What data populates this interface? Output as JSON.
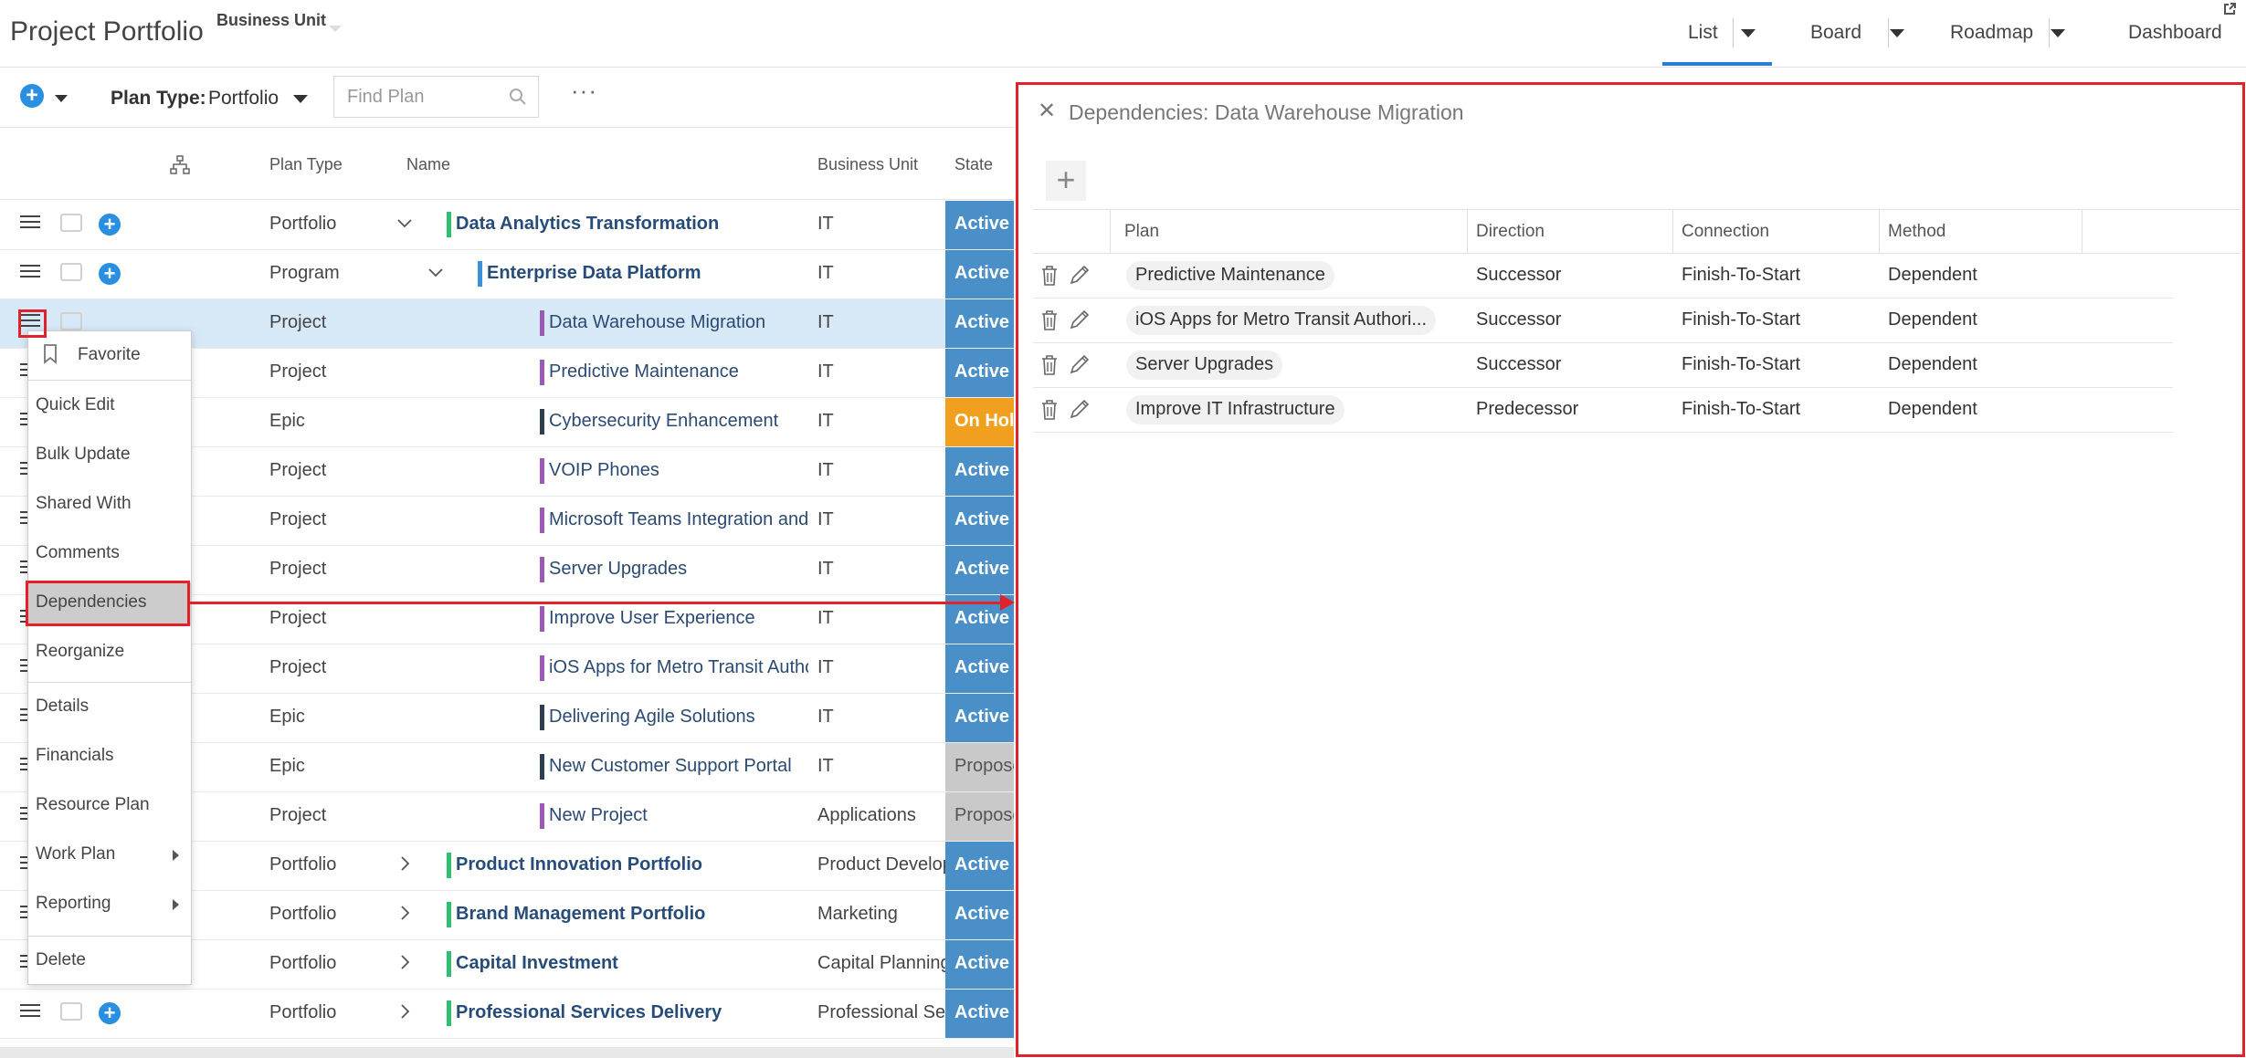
{
  "header": {
    "app_title": "Project Portfolio",
    "business_unit_label": "Business Unit",
    "views": [
      "List",
      "Board",
      "Roadmap",
      "Dashboard"
    ],
    "active_view": "List"
  },
  "toolbar": {
    "plan_type_label": "Plan Type:",
    "plan_type_value": "Portfolio",
    "search_placeholder": "Find Plan",
    "more_label": "···"
  },
  "grid": {
    "columns": [
      "Plan Type",
      "Name",
      "Business Unit",
      "State"
    ],
    "rows": [
      {
        "type": "Portfolio",
        "name": "Data Analytics Transformation",
        "bu": "IT",
        "state": "Active"
      },
      {
        "type": "Program",
        "name": "Enterprise Data Platform",
        "bu": "IT",
        "state": "Active"
      },
      {
        "type": "Project",
        "name": "Data Warehouse Migration",
        "bu": "IT",
        "state": "Active"
      },
      {
        "type": "Project",
        "name": "Predictive Maintenance",
        "bu": "IT",
        "state": "Active"
      },
      {
        "type": "Epic",
        "name": "Cybersecurity Enhancement",
        "bu": "IT",
        "state": "On Hold"
      },
      {
        "type": "Project",
        "name": "VOIP Phones",
        "bu": "IT",
        "state": "Active"
      },
      {
        "type": "Project",
        "name": "Microsoft Teams Integration and me",
        "bu": "IT",
        "state": "Active"
      },
      {
        "type": "Project",
        "name": "Server Upgrades",
        "bu": "IT",
        "state": "Active"
      },
      {
        "type": "Project",
        "name": "Improve User Experience",
        "bu": "IT",
        "state": "Active"
      },
      {
        "type": "Project",
        "name": "iOS Apps for Metro Transit Authority",
        "bu": "IT",
        "state": "Active"
      },
      {
        "type": "Epic",
        "name": "Delivering Agile Solutions",
        "bu": "IT",
        "state": "Active"
      },
      {
        "type": "Epic",
        "name": "New Customer Support Portal",
        "bu": "IT",
        "state": "Proposed"
      },
      {
        "type": "Project",
        "name": "New Project",
        "bu": "Applications",
        "state": "Proposed"
      },
      {
        "type": "Portfolio",
        "name": "Product Innovation Portfolio",
        "bu": "Product Development",
        "state": "Active"
      },
      {
        "type": "Portfolio",
        "name": "Brand Management Portfolio",
        "bu": "Marketing",
        "state": "Active"
      },
      {
        "type": "Portfolio",
        "name": "Capital Investment",
        "bu": "Capital Planning",
        "state": "Active"
      },
      {
        "type": "Portfolio",
        "name": "Professional Services Delivery",
        "bu": "Professional Services",
        "state": "Active"
      }
    ],
    "colors": {
      "portfolio_bar": "#2fbf71",
      "program_bar": "#3a8fd9",
      "project_bar": "#9b59b6",
      "epic_bar": "#2d3e50"
    }
  },
  "context_menu": {
    "items": [
      "Favorite",
      "Quick Edit",
      "Bulk Update",
      "Shared With",
      "Comments",
      "Dependencies",
      "Reorganize",
      "Details",
      "Financials",
      "Resource Plan",
      "Work Plan",
      "Reporting",
      "Delete"
    ],
    "active_item": "Dependencies"
  },
  "dependencies": {
    "title": "Dependencies: Data Warehouse Migration",
    "columns": [
      "Plan",
      "Direction",
      "Connection",
      "Method"
    ],
    "rows": [
      {
        "plan": "Predictive Maintenance",
        "direction": "Successor",
        "connection": "Finish-To-Start",
        "method": "Dependent"
      },
      {
        "plan": "iOS Apps for Metro Transit Authori...",
        "direction": "Successor",
        "connection": "Finish-To-Start",
        "method": "Dependent"
      },
      {
        "plan": "Server Upgrades",
        "direction": "Successor",
        "connection": "Finish-To-Start",
        "method": "Dependent"
      },
      {
        "plan": "Improve IT Infrastructure",
        "direction": "Predecessor",
        "connection": "Finish-To-Start",
        "method": "Dependent"
      }
    ]
  },
  "annotation_color": "#e0232b"
}
